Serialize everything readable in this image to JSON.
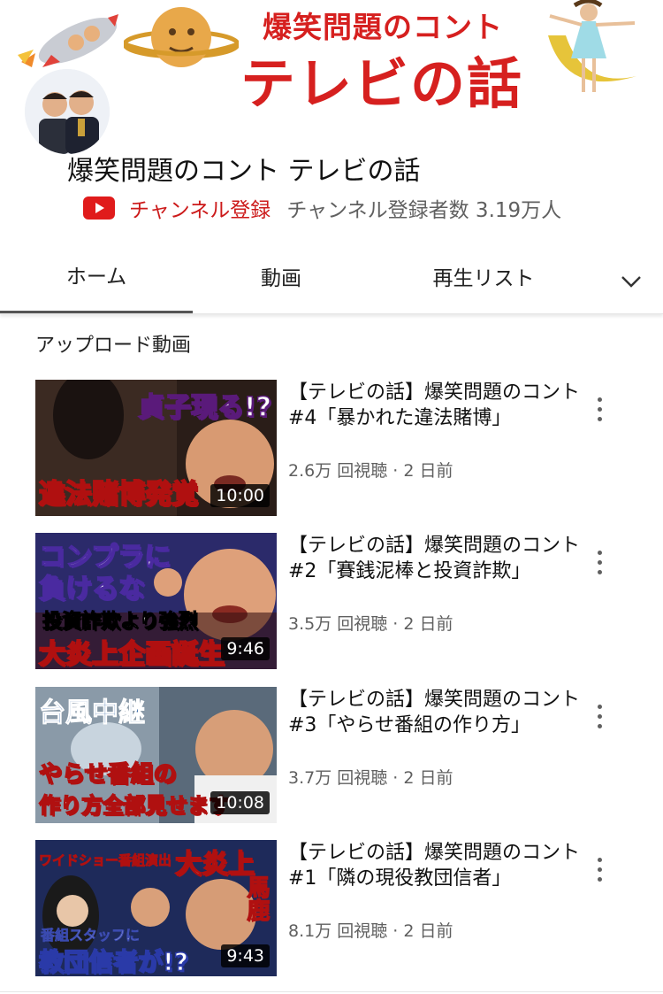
{
  "banner": {
    "line1": "爆笑問題のコント",
    "line2": "テレビの話"
  },
  "channel": {
    "name": "爆笑問題のコント テレビの話",
    "subscribe_label": "チャンネル登録",
    "subscriber_text": "チャンネル登録者数 3.19万人"
  },
  "tabs": [
    {
      "label": "ホーム",
      "selected": true
    },
    {
      "label": "動画"
    },
    {
      "label": "再生リスト"
    }
  ],
  "section": {
    "title": "アップロード動画"
  },
  "videos": [
    {
      "title": "【テレビの話】爆笑問題のコント#4「暴かれた違法賭博」",
      "meta": "2.6万 回視聴 · 2 日前",
      "duration": "10:00",
      "thumb_text_top": "貞子現る!?",
      "thumb_text_bottom": "違法賭博発覚"
    },
    {
      "title": "【テレビの話】爆笑問題のコント#2「賽銭泥棒と投資詐欺」",
      "meta": "3.5万 回視聴 · 2 日前",
      "duration": "9:46",
      "thumb_text_top": "コンプラに",
      "thumb_text_top2": "負けるな",
      "thumb_text_mid": "投資詐欺より強烈",
      "thumb_text_bottom": "大炎上企画誕生"
    },
    {
      "title": "【テレビの話】爆笑問題のコント#3「やらせ番組の作り方」",
      "meta": "3.7万 回視聴 · 2 日前",
      "duration": "10:08",
      "thumb_text_top": "台風中継",
      "thumb_text_mid": "やらせ番組の",
      "thumb_text_bottom": "作り方全部見せます"
    },
    {
      "title": "【テレビの話】爆笑問題のコント#1「隣の現役教団信者」",
      "meta": "8.1万 回視聴 · 2 日前",
      "duration": "9:43",
      "thumb_text_top": "ワイドショー番組演出",
      "thumb_text_top2": "大炎上",
      "thumb_text_side": "馬鹿",
      "thumb_text_mid": "番組スタッフに",
      "thumb_text_bottom": "教団信者が!?"
    }
  ],
  "colors": {
    "accent": "#cc1a1a",
    "banner_red": "#d6201f",
    "meta_gray": "#606060"
  },
  "icons": [
    "youtube-logo-icon",
    "chevron-down-icon",
    "more-vert-icon"
  ]
}
